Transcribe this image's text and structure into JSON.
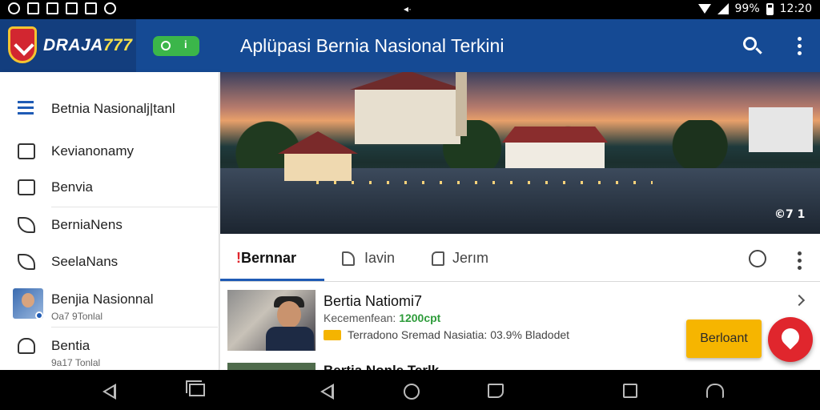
{
  "status_bar": {
    "center_glyph": "◂·",
    "battery": "99%",
    "time": "12:20"
  },
  "header": {
    "brand_main": "DRAJA",
    "brand_accent": "777",
    "pill_mark": "i",
    "title": "Aplüpasi Bernia Nasional Terkini",
    "colors": {
      "bar": "#154a94",
      "pill": "#3bb64a"
    }
  },
  "drawer": {
    "items": [
      {
        "label": "Betnia Nasionalj|tanl",
        "icon": "menu-icon"
      },
      {
        "label": "Kevianonamy",
        "icon": "thumbs-up-icon"
      },
      {
        "label": "Benvia",
        "icon": "image-icon"
      },
      {
        "label": "BerniaNens",
        "icon": "leaf-icon"
      },
      {
        "label": "SeelaNans",
        "icon": "rocket-icon"
      },
      {
        "label": "Benjia Nasionnal",
        "sub": "Oa7 9Tonlal",
        "icon": "avatar"
      },
      {
        "label": "Bentia",
        "sub": "9a17 Tonlal",
        "icon": "bell-icon"
      }
    ]
  },
  "hero": {
    "count": "©7 1"
  },
  "tabs": [
    {
      "label": "Bernnar",
      "prefix": "!",
      "active": true
    },
    {
      "label": "Iavin",
      "icon": "arrow-icon"
    },
    {
      "label": "Jerım",
      "icon": "tag-icon"
    }
  ],
  "news": {
    "title": "Bertia Natiomi7",
    "sub_label": "Kecemenfean:",
    "sub_value": "1200cpt",
    "meta": "Terradono Sremad Nasiatia: 03.9% Bladodet",
    "peek_title": "Bertia Nonle Terlk"
  },
  "cta": {
    "label": "Berloant"
  },
  "colors": {
    "accent": "#1f5bb5",
    "cta": "#f6b500",
    "fab": "#e0262d"
  }
}
